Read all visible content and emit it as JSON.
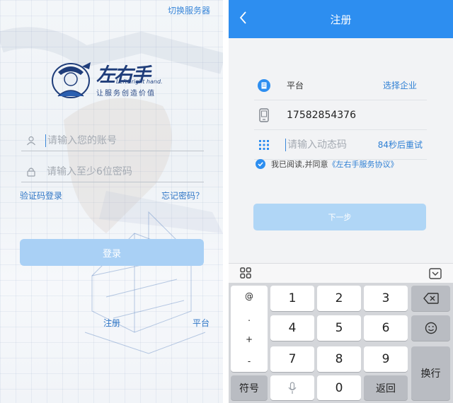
{
  "login": {
    "switch_server": "切换服务器",
    "logo_cn": "左右手",
    "logo_en": "Left&right hand.",
    "logo_slogan": "让服务创造价值",
    "account_placeholder": "请输入您的账号",
    "password_placeholder": "请输入至少6位密码",
    "sms_login": "验证码登录",
    "forgot_password": "忘记密码？",
    "login_button": "登录",
    "register": "注册",
    "platform": "平台"
  },
  "register": {
    "title": "注册",
    "platform_label": "平台",
    "select_company": "选择企业",
    "phone": "17582854376",
    "code_placeholder": "请输入动态码",
    "retry": "84秒后重试",
    "agree_text": "我已阅读,并同意",
    "agreement": "《左右手服务协议》",
    "next_button": "下一步"
  },
  "keyboard": {
    "left_col": [
      "@",
      ".",
      "+",
      "-"
    ],
    "symbols": "符号",
    "digits": [
      "1",
      "2",
      "3",
      "4",
      "5",
      "6",
      "7",
      "8",
      "9",
      "0"
    ],
    "back": "返回",
    "newline": "换行"
  },
  "icons": {
    "back": "chevron-left-icon",
    "user": "user-icon",
    "lock": "lock-icon",
    "platform": "building-icon",
    "phone": "phone-icon",
    "code": "grid-dots-icon",
    "check": "check-icon",
    "backspace": "backspace-icon",
    "emoji": "emoji-icon",
    "mic": "microphone-icon",
    "kb_grid": "app-grid-icon",
    "kb_hide": "keyboard-hide-icon"
  },
  "colors": {
    "primary": "#2d8ef0",
    "link": "#2f76c6",
    "button_disabled": "#a9d0f5"
  }
}
